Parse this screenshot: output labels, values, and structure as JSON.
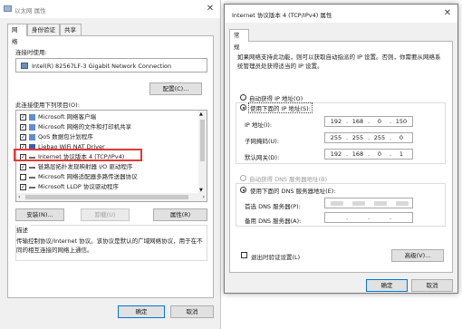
{
  "left_window": {
    "title": "以太网 属性",
    "tabs": [
      "网络",
      "身份验证",
      "共享"
    ],
    "connect_label": "连接时使用:",
    "adapter": "Intel(R) 82567LF-3 Gigabit Network Connection",
    "configure_button": "配置(C)...",
    "items_label": "此连接使用下列项目(O):",
    "items": [
      {
        "label": "Microsoft 网络客户端",
        "checked": true,
        "icon": "network-client-icon"
      },
      {
        "label": "Microsoft 网络的文件和打印机共享",
        "checked": true,
        "icon": "file-share-icon"
      },
      {
        "label": "QoS 数据包计划程序",
        "checked": true,
        "icon": "qos-icon"
      },
      {
        "label": "Liebao WiFi NAT Driver",
        "checked": true,
        "icon": "driver-icon"
      },
      {
        "label": "Internet 协议版本 4 (TCP/IPv4)",
        "checked": true,
        "icon": "protocol-icon"
      },
      {
        "label": "链路层拓扑发现映射器 I/O 驱动程序",
        "checked": true,
        "icon": "protocol-icon"
      },
      {
        "label": "Microsoft 网络适配器多路传送器协议",
        "checked": false,
        "icon": "protocol-icon"
      },
      {
        "label": "Microsoft LLDP 协议驱动程序",
        "checked": true,
        "icon": "protocol-icon"
      }
    ],
    "install_button": "安装(N)...",
    "uninstall_button": "卸载(U)",
    "properties_button": "属性(R)",
    "description_title": "描述",
    "description": "传输控制协议/Internet 协议。该协议是默认的广域网络协议，用于在不同的相互连接的网络上通信。",
    "ok_button": "确定",
    "cancel_button": "取消",
    "highlight_color": "#e53935"
  },
  "right_window": {
    "title": "Internet 协议版本 4 (TCP/IPv4) 属性",
    "tab": "常规",
    "intro": "如果网络支持此功能，则可以获取自动指派的 IP 设置。否则，你需要从网络系统管理员处获得适当的 IP 设置。",
    "auto_ip": "自动获得 IP 地址(O)",
    "manual_ip": "使用下面的 IP 地址(S):",
    "ip_label": "IP 地址(I):",
    "ip_value": [
      "192",
      "168",
      "0",
      "150"
    ],
    "mask_label": "子网掩码(U):",
    "mask_value": [
      "255",
      "255",
      "255",
      "0"
    ],
    "gateway_label": "默认网关(D):",
    "gateway_value": [
      "192",
      "168",
      "0",
      "1"
    ],
    "auto_dns": "自动获得 DNS 服务器地址(B)",
    "manual_dns": "使用下面的 DNS 服务器地址(E):",
    "dns1_label": "首选 DNS 服务器(P):",
    "dns2_label": "备用 DNS 服务器(A):",
    "validate_label": "退出时验证设置(L)",
    "advanced_button": "高级(V)...",
    "ok_button": "确定",
    "cancel_button": "取消"
  }
}
